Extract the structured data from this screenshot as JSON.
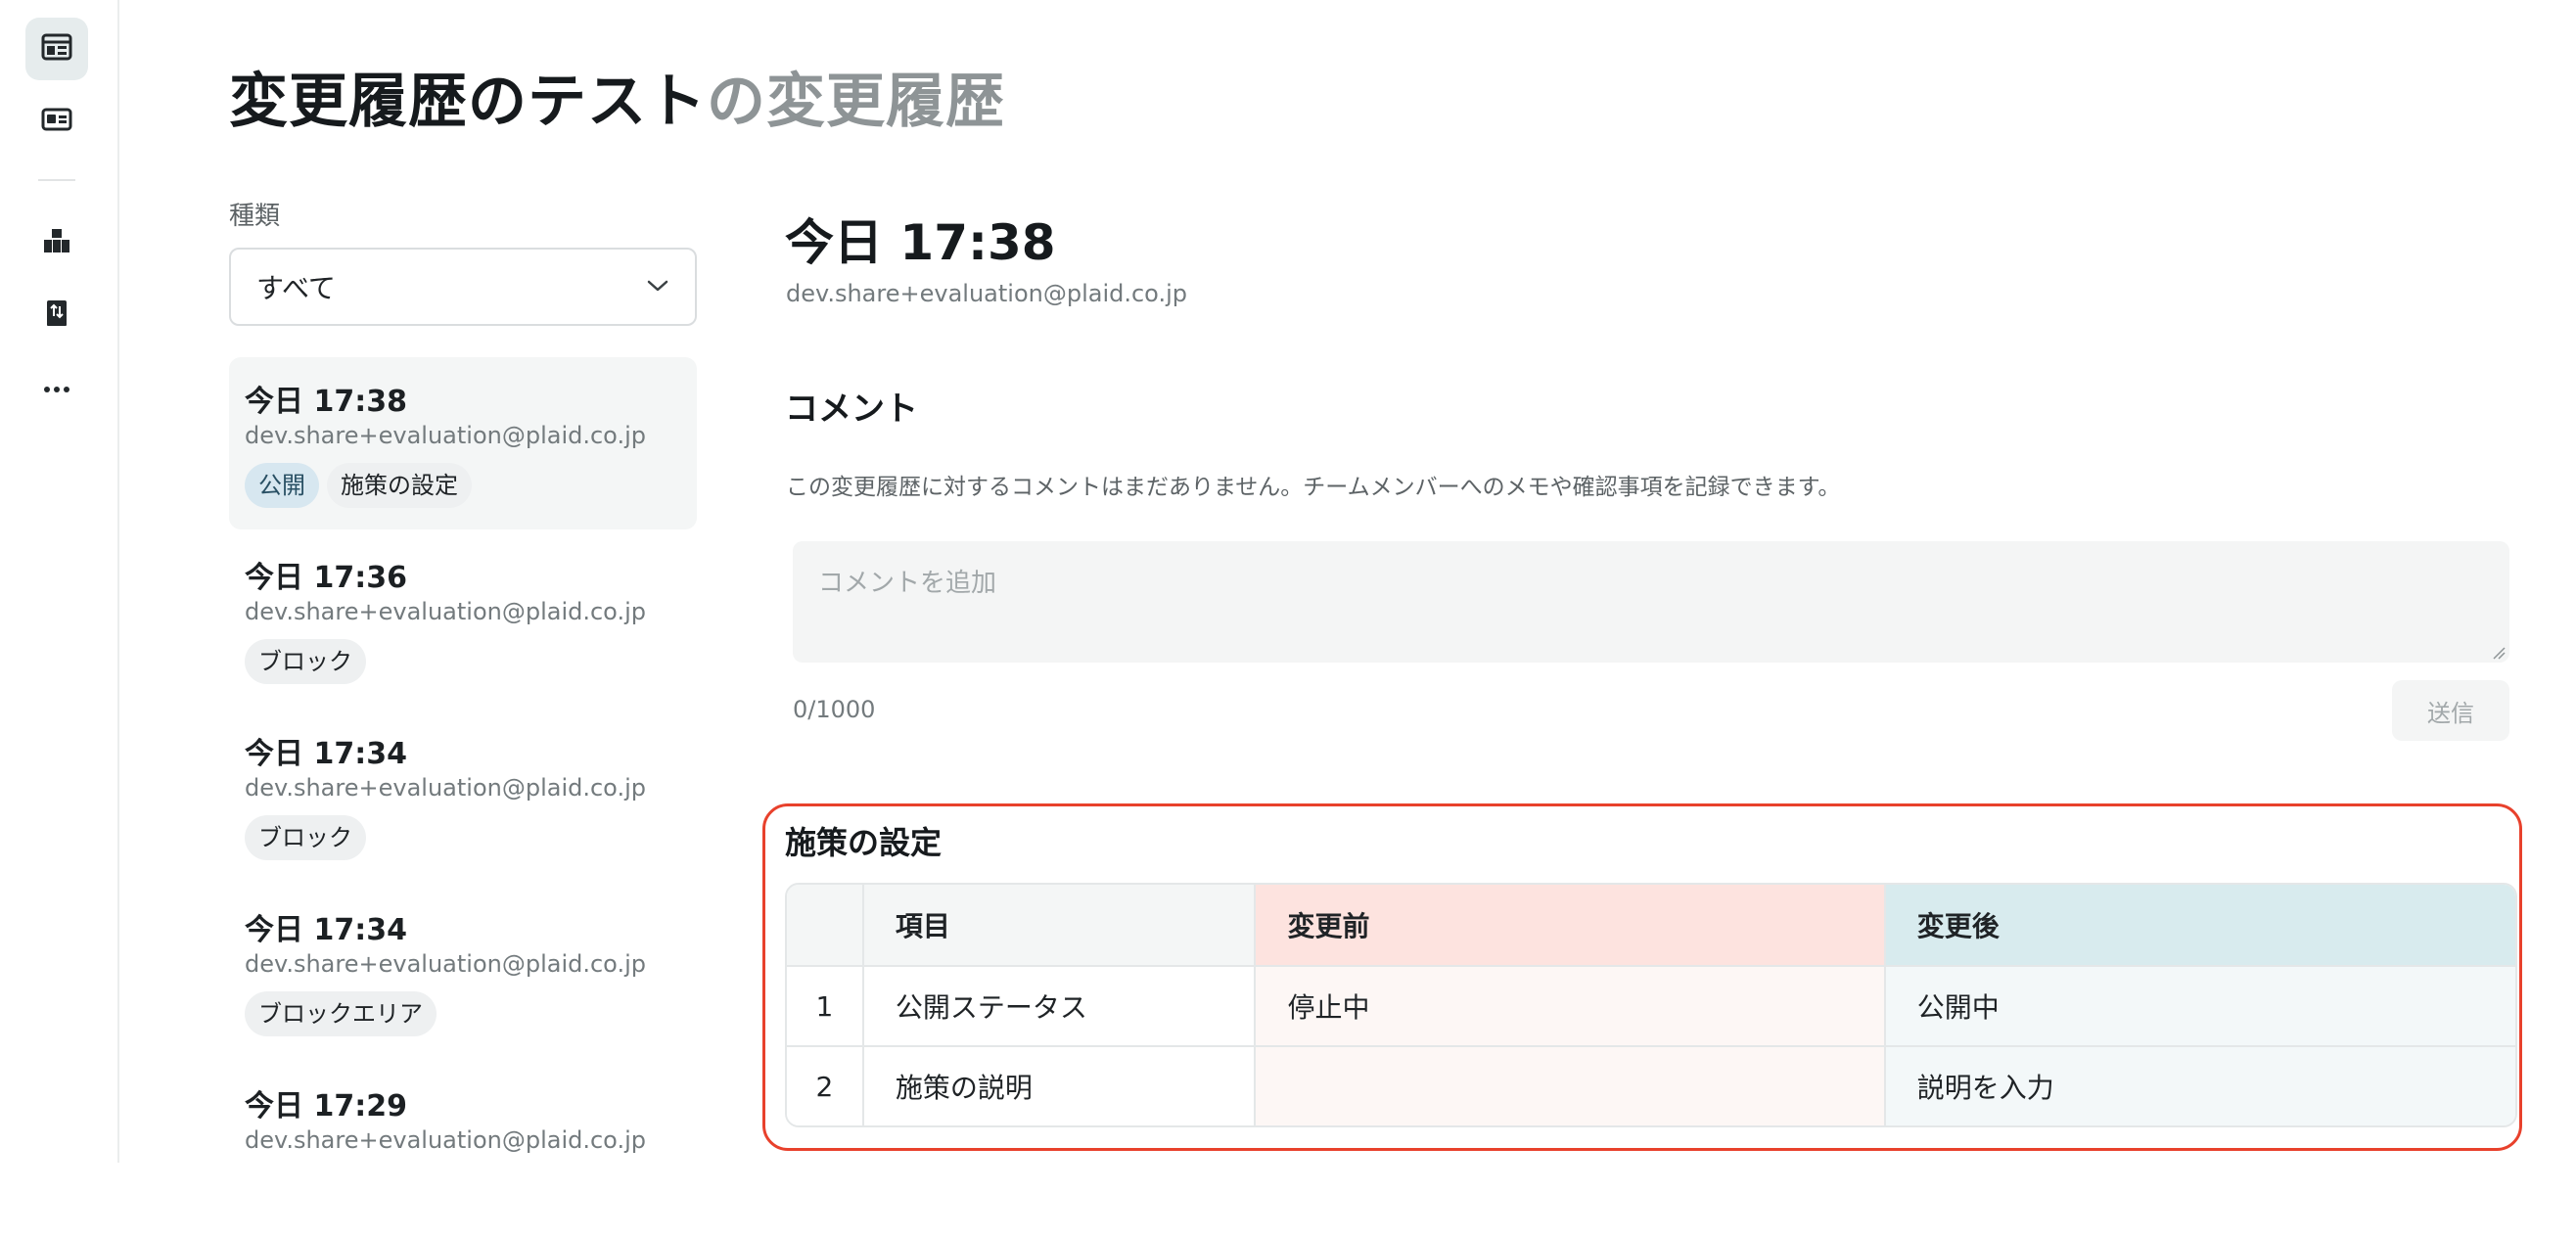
{
  "page": {
    "title_strong": "変更履歴のテスト",
    "title_suffix": "の変更履歴"
  },
  "filter": {
    "label": "種類",
    "selected": "すべて"
  },
  "history": [
    {
      "time": "今日 17:38",
      "user": "dev.share+evaluation@plaid.co.jp",
      "tags": [
        "公開",
        "施策の設定"
      ]
    },
    {
      "time": "今日 17:36",
      "user": "dev.share+evaluation@plaid.co.jp",
      "tags": [
        "ブロック"
      ]
    },
    {
      "time": "今日 17:34",
      "user": "dev.share+evaluation@plaid.co.jp",
      "tags": [
        "ブロック"
      ]
    },
    {
      "time": "今日 17:34",
      "user": "dev.share+evaluation@plaid.co.jp",
      "tags": [
        "ブロックエリア"
      ]
    },
    {
      "time": "今日 17:29",
      "user": "dev.share+evaluation@plaid.co.jp",
      "tags": []
    }
  ],
  "detail": {
    "time": "今日 17:38",
    "user": "dev.share+evaluation@plaid.co.jp",
    "comment_heading": "コメント",
    "comment_empty": "この変更履歴に対するコメントはまだありません。チームメンバーへのメモや確認事項を記録できます。",
    "comment_placeholder": "コメントを追加",
    "char_count": "0/1000",
    "send_label": "送信"
  },
  "changes": {
    "heading": "施策の設定",
    "columns": [
      "",
      "項目",
      "変更前",
      "変更後"
    ],
    "rows": [
      {
        "num": "1",
        "item": "公開ステータス",
        "before": "停止中",
        "after": "公開中"
      },
      {
        "num": "2",
        "item": "施策の説明",
        "before": "",
        "after": "説明を入力"
      }
    ]
  },
  "sidebar": {
    "icons": [
      "browser-window-icon",
      "id-card-icon",
      "blocks-icon",
      "sort-book-icon",
      "more-icon"
    ]
  },
  "colors": {
    "accent_border": "#e8412c",
    "public_tag_bg": "#d7e7f0",
    "before_header_bg": "#fde3df",
    "after_header_bg": "#d8ebee"
  }
}
